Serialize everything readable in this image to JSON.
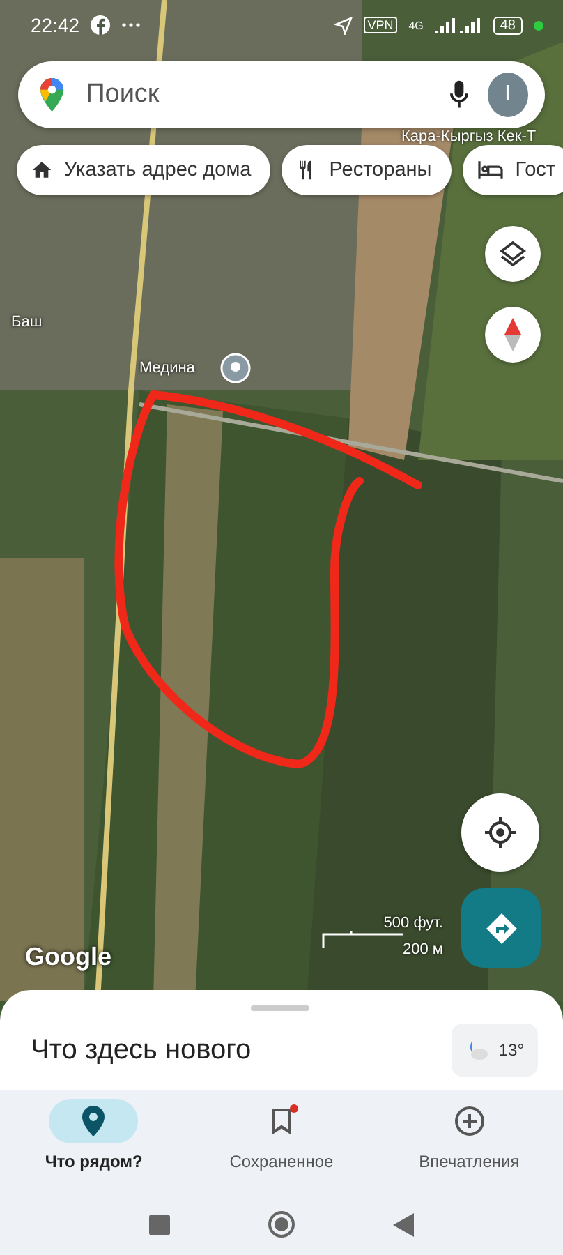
{
  "status_bar": {
    "time": "22:42",
    "network": "4G",
    "vpn": "VPN",
    "battery": "48"
  },
  "search": {
    "placeholder": "Поиск",
    "avatar": "I"
  },
  "chips": [
    {
      "kind": "home",
      "label": "Указать адрес дома"
    },
    {
      "kind": "food",
      "label": "Рестораны"
    },
    {
      "kind": "hotel",
      "label": "Гост"
    }
  ],
  "map": {
    "labels": [
      {
        "kind": "place",
        "text": "Медина"
      },
      {
        "kind": "plain",
        "text": "Баш"
      },
      {
        "kind": "road",
        "text": "Кара-Кыргыз Кек-Т"
      }
    ],
    "scale_top": "500 фут.",
    "scale_bottom": "200 м",
    "logo": "Google"
  },
  "sheet": {
    "title": "Что здесь нового",
    "temperature": "13°"
  },
  "nav": [
    {
      "kind": "pin",
      "label": "Что рядом?",
      "selected": true,
      "badge": false
    },
    {
      "kind": "bookmark",
      "label": "Сохраненное",
      "selected": false,
      "badge": true
    },
    {
      "kind": "plus",
      "label": "Впечатления",
      "selected": false,
      "badge": false
    }
  ]
}
